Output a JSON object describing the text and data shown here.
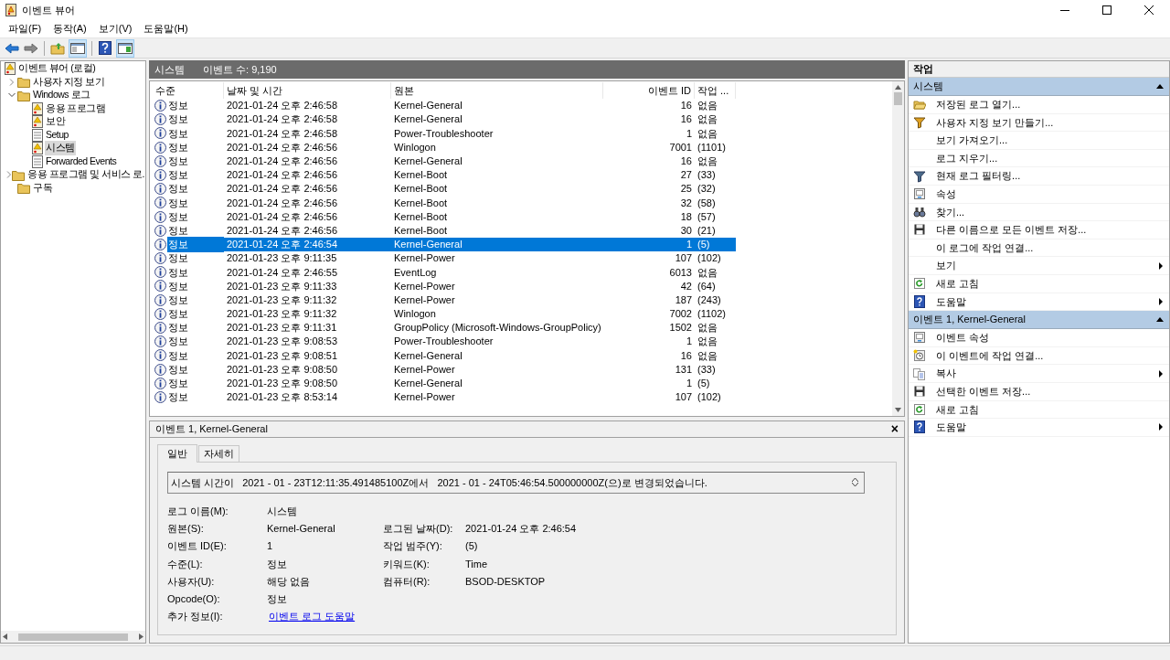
{
  "window": {
    "title": "이벤트 뷰어"
  },
  "menu": [
    "파일(F)",
    "동작(A)",
    "보기(V)",
    "도움말(H)"
  ],
  "tree": [
    {
      "label": "이벤트 뷰어 (로컬)",
      "selected": false,
      "children": [
        {
          "label": "사용자 지정 보기",
          "selected": false,
          "expanded": false
        },
        {
          "label": "Windows 로그",
          "selected": false,
          "expanded": true,
          "children": [
            {
              "label": "응용 프로그램",
              "selected": false
            },
            {
              "label": "보안",
              "selected": false
            },
            {
              "label": "Setup",
              "selected": false
            },
            {
              "label": "시스템",
              "selected": true
            },
            {
              "label": "Forwarded Events",
              "selected": false
            }
          ]
        },
        {
          "label": "응용 프로그램 및 서비스 로.",
          "selected": false,
          "expanded": false
        },
        {
          "label": "구독",
          "selected": false
        }
      ]
    }
  ],
  "log_header": {
    "name": "시스템",
    "count": "이벤트 수: 9,190"
  },
  "table": {
    "columns": [
      "수준",
      "날짜 및 시간",
      "원본",
      "이벤트 ID",
      "작업 ..."
    ],
    "rows": [
      {
        "level": "정보",
        "date": "2021-01-24 오후 2:46:58",
        "source": "Kernel-General",
        "event_id": "16",
        "task": "없음",
        "selected": false
      },
      {
        "level": "정보",
        "date": "2021-01-24 오후 2:46:58",
        "source": "Kernel-General",
        "event_id": "16",
        "task": "없음",
        "selected": false
      },
      {
        "level": "정보",
        "date": "2021-01-24 오후 2:46:58",
        "source": "Power-Troubleshooter",
        "event_id": "1",
        "task": "없음",
        "selected": false
      },
      {
        "level": "정보",
        "date": "2021-01-24 오후 2:46:56",
        "source": "Winlogon",
        "event_id": "7001",
        "task": "(1101)",
        "selected": false
      },
      {
        "level": "정보",
        "date": "2021-01-24 오후 2:46:56",
        "source": "Kernel-General",
        "event_id": "16",
        "task": "없음",
        "selected": false
      },
      {
        "level": "정보",
        "date": "2021-01-24 오후 2:46:56",
        "source": "Kernel-Boot",
        "event_id": "27",
        "task": "(33)",
        "selected": false
      },
      {
        "level": "정보",
        "date": "2021-01-24 오후 2:46:56",
        "source": "Kernel-Boot",
        "event_id": "25",
        "task": "(32)",
        "selected": false
      },
      {
        "level": "정보",
        "date": "2021-01-24 오후 2:46:56",
        "source": "Kernel-Boot",
        "event_id": "32",
        "task": "(58)",
        "selected": false
      },
      {
        "level": "정보",
        "date": "2021-01-24 오후 2:46:56",
        "source": "Kernel-Boot",
        "event_id": "18",
        "task": "(57)",
        "selected": false
      },
      {
        "level": "정보",
        "date": "2021-01-24 오후 2:46:56",
        "source": "Kernel-Boot",
        "event_id": "30",
        "task": "(21)",
        "selected": false
      },
      {
        "level": "정보",
        "date": "2021-01-24 오후 2:46:54",
        "source": "Kernel-General",
        "event_id": "1",
        "task": "(5)",
        "selected": true
      },
      {
        "level": "정보",
        "date": "2021-01-23 오후 9:11:35",
        "source": "Kernel-Power",
        "event_id": "107",
        "task": "(102)",
        "selected": false
      },
      {
        "level": "정보",
        "date": "2021-01-24 오후 2:46:55",
        "source": "EventLog",
        "event_id": "6013",
        "task": "없음",
        "selected": false
      },
      {
        "level": "정보",
        "date": "2021-01-23 오후 9:11:33",
        "source": "Kernel-Power",
        "event_id": "42",
        "task": "(64)",
        "selected": false
      },
      {
        "level": "정보",
        "date": "2021-01-23 오후 9:11:32",
        "source": "Kernel-Power",
        "event_id": "187",
        "task": "(243)",
        "selected": false
      },
      {
        "level": "정보",
        "date": "2021-01-23 오후 9:11:32",
        "source": "Winlogon",
        "event_id": "7002",
        "task": "(1102)",
        "selected": false
      },
      {
        "level": "정보",
        "date": "2021-01-23 오후 9:11:31",
        "source": "GroupPolicy (Microsoft-Windows-GroupPolicy)",
        "event_id": "1502",
        "task": "없음",
        "selected": false
      },
      {
        "level": "정보",
        "date": "2021-01-23 오후 9:08:53",
        "source": "Power-Troubleshooter",
        "event_id": "1",
        "task": "없음",
        "selected": false
      },
      {
        "level": "정보",
        "date": "2021-01-23 오후 9:08:51",
        "source": "Kernel-General",
        "event_id": "16",
        "task": "없음",
        "selected": false
      },
      {
        "level": "정보",
        "date": "2021-01-23 오후 9:08:50",
        "source": "Kernel-Power",
        "event_id": "131",
        "task": "(33)",
        "selected": false
      },
      {
        "level": "정보",
        "date": "2021-01-23 오후 9:08:50",
        "source": "Kernel-General",
        "event_id": "1",
        "task": "(5)",
        "selected": false
      },
      {
        "level": "정보",
        "date": "2021-01-23 오후 8:53:14",
        "source": "Kernel-Power",
        "event_id": "107",
        "task": "(102)",
        "selected": false
      }
    ]
  },
  "detail": {
    "title": "이벤트 1, Kernel-General",
    "close": "×",
    "tabs": [
      {
        "label": "일반",
        "selected": true
      },
      {
        "label": "자세히",
        "selected": false
      }
    ],
    "message": "시스템 시간이   2021 ‎-‎ 01 ‎-‎ 23T12:11:35.491485100Z에서   2021 ‎-‎ 01 ‎-‎ 24T05:46:54.500000000Z(으)로 변경되었습니다.",
    "fields": [
      {
        "label": "로그 이름(M):",
        "value": "시스템"
      },
      {
        "label": "원본(S):",
        "value": "Kernel-General",
        "label_2": "로그된 날짜(D):",
        "value_2": "2021-01-24 오후 2:46:54"
      },
      {
        "label": "이벤트 ID(E):",
        "value": "1",
        "label_2": "작업 범주(Y):",
        "value_2": "(5)"
      },
      {
        "label": "수준(L):",
        "value": "정보",
        "label_2": "키워드(K):",
        "value_2": "Time"
      },
      {
        "label": "사용자(U):",
        "value": "해당 없음",
        "label_2": "컴퓨터(R):",
        "value_2": "BSOD-DESKTOP"
      },
      {
        "label": "Opcode(O):",
        "value": "정보"
      }
    ],
    "more_info": {
      "label": "추가 정보(I):",
      "link": "이벤트 로그 도움말"
    }
  },
  "actions": {
    "title": "작업",
    "sections": [
      {
        "title": "시스템",
        "expanded": true,
        "items": [
          {
            "label": "저장된 로그 열기...",
            "submenu": false
          },
          {
            "label": "사용자 지정 보기 만들기...",
            "submenu": false
          },
          {
            "label": "보기 가져오기...",
            "submenu": false
          },
          {
            "label": "로그 지우기...",
            "submenu": false
          },
          {
            "label": "현재 로그 필터링...",
            "submenu": false
          },
          {
            "label": "속성",
            "submenu": false
          },
          {
            "label": "찾기...",
            "submenu": false
          },
          {
            "label": "다른 이름으로 모든 이벤트 저장...",
            "submenu": false
          },
          {
            "label": "이 로그에 작업 연결...",
            "submenu": false
          },
          {
            "label": "보기",
            "submenu": true
          },
          {
            "label": "새로 고침",
            "submenu": false
          },
          {
            "label": "도움말",
            "submenu": true
          }
        ]
      },
      {
        "title": "이벤트 1, Kernel-General",
        "expanded": true,
        "items": [
          {
            "label": "이벤트 속성",
            "submenu": false
          },
          {
            "label": "이 이벤트에 작업 연결...",
            "submenu": false
          },
          {
            "label": "복사",
            "submenu": true
          },
          {
            "label": "선택한 이벤트 저장...",
            "submenu": false
          },
          {
            "label": "새로 고침",
            "submenu": false
          },
          {
            "label": "도움말",
            "submenu": true
          }
        ]
      }
    ]
  }
}
